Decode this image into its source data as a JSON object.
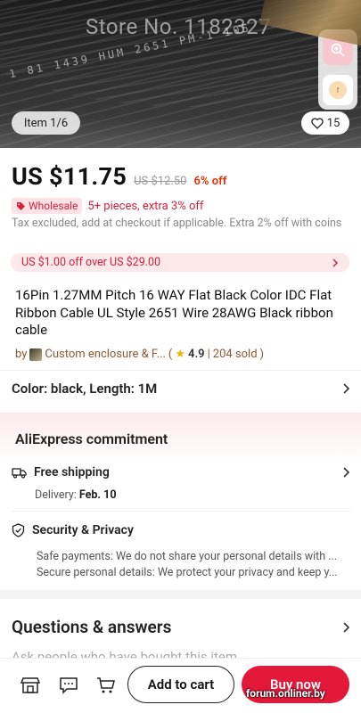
{
  "gallery": {
    "watermark": "Store No. 1182327",
    "wire_print": "1 81 1439 HUM 2651 PM-1 105",
    "item_counter": "Item 1/6",
    "likes": "15"
  },
  "price": {
    "current": "US $11.75",
    "original": "US $12.50",
    "discount": "6% off"
  },
  "wholesale": {
    "badge": "Wholesale",
    "text": "5+ pieces, extra 3% off"
  },
  "tax_note": "Tax excluded, add at checkout if applicable. Extra 2% off with coins",
  "coupon": "US $1.00 off over US $29.00",
  "product_title": "16Pin 1.27MM Pitch 16 WAY Flat Black Color IDC Flat Ribbon Cable UL Style 2651 Wire 28AWG Black ribbon cable",
  "seller": {
    "by": "by",
    "store_name": "Custom enclosure & F...",
    "open_paren": "(",
    "rating": "4.9",
    "separator": "|",
    "sold": "204 sold",
    "close_paren": ")"
  },
  "variant": "Color: black, Length: 1M",
  "commitment": {
    "title": "AliExpress commitment",
    "shipping_title": "Free shipping",
    "delivery_label": "Delivery:",
    "delivery_date": "Feb. 10",
    "security_title": "Security & Privacy",
    "security_line1": "Safe payments: We do not share your personal details with ...",
    "security_line2": "Secure personal details: We protect your privacy and keep y..."
  },
  "qa": {
    "title": "Questions & answers",
    "subtitle": "Ask people who have bought this item"
  },
  "bottom": {
    "add_to_cart": "Add to cart",
    "buy_now": "Buy now",
    "watermark": "forum.onliner.by"
  },
  "colors": {
    "accent": "#e4193a",
    "discount": "#e62e04",
    "seller": "#8a5a33"
  },
  "icons": [
    "zoom-icon",
    "store-thumb-icon",
    "heart-icon",
    "tag-icon",
    "chevron-right-icon",
    "truck-icon",
    "shield-icon",
    "store-icon",
    "chat-icon",
    "cart-icon",
    "star-icon"
  ]
}
